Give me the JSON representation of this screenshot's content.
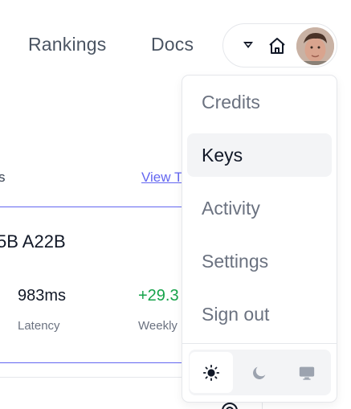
{
  "nav": {
    "rankings_label": "Rankings",
    "docs_label": "Docs"
  },
  "user_menu": {
    "caret_icon": "caret-down-icon",
    "home_icon": "home-icon",
    "avatar": "user-avatar"
  },
  "background": {
    "section_heading_fragment": "s",
    "view_link": "View T",
    "model_name_fragment": "5B A22B",
    "latency_value": "983ms",
    "latency_label": "Latency",
    "weekly_value": "+29.3",
    "weekly_label": "Weekly"
  },
  "dropdown": {
    "items": [
      {
        "label": "Credits",
        "active": false
      },
      {
        "label": "Keys",
        "active": true
      },
      {
        "label": "Activity",
        "active": false
      },
      {
        "label": "Settings",
        "active": false
      },
      {
        "label": "Sign out",
        "active": false
      }
    ],
    "theme": {
      "options": [
        "light",
        "dark",
        "system"
      ],
      "selected": "light",
      "icons": [
        "sun-icon",
        "moon-icon",
        "monitor-icon"
      ]
    }
  },
  "colors": {
    "accent": "#6366f1",
    "positive": "#16a34a",
    "active_bg": "#f3f4f6"
  }
}
